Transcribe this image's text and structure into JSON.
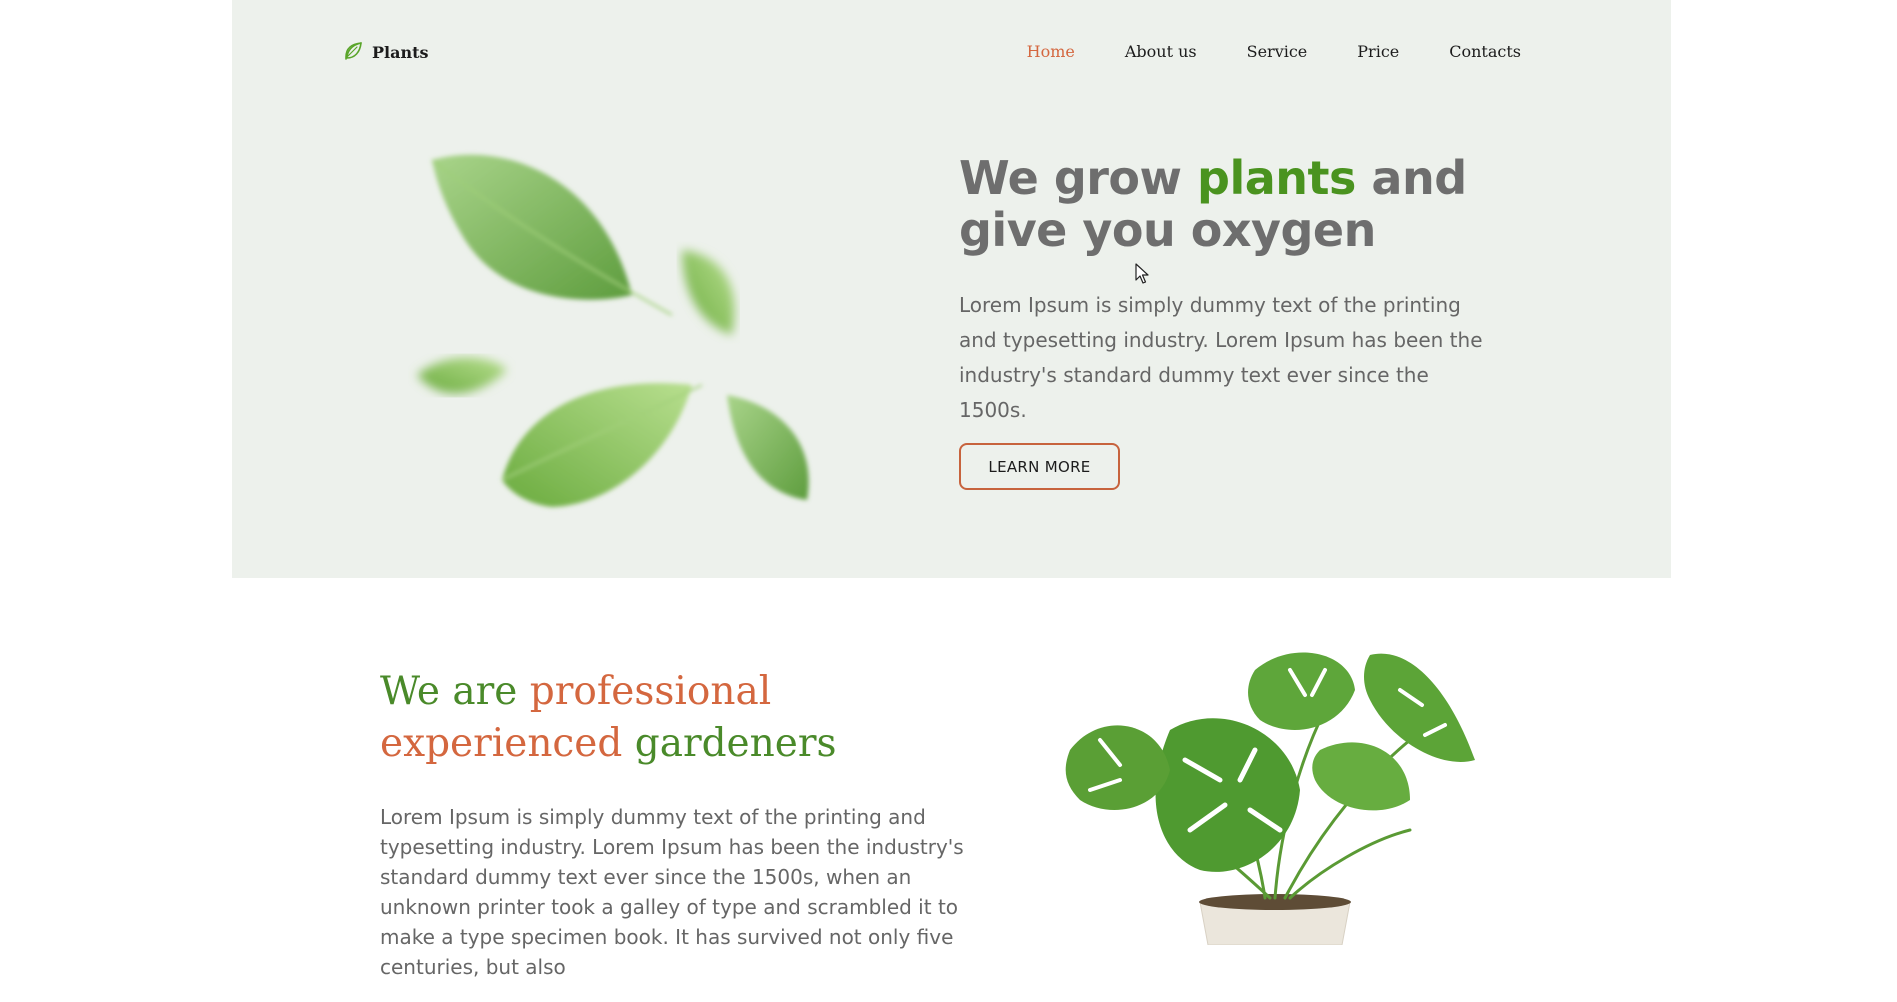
{
  "brand": {
    "name": "Plants",
    "icon": "leaf-icon"
  },
  "nav": {
    "items": [
      {
        "label": "Home",
        "active": true
      },
      {
        "label": "About us",
        "active": false
      },
      {
        "label": "Service",
        "active": false
      },
      {
        "label": "Price",
        "active": false
      },
      {
        "label": "Contacts",
        "active": false
      }
    ]
  },
  "hero": {
    "title_part1": "We grow ",
    "title_accent": "plants",
    "title_part2": " and give you oxygen",
    "text": "Lorem Ipsum is simply dummy text of the printing and typesetting industry. Lorem Ipsum has been the industry's standard dummy text ever since the 1500s.",
    "button_label": "LEARN MORE"
  },
  "about": {
    "title_part1": "We are ",
    "title_part2": "professional experienced",
    "title_part3": " gardeners",
    "text": "Lorem Ipsum is simply dummy text of the printing and typesetting industry. Lorem Ipsum has been the industry's standard dummy text ever since the 1500s, when an unknown printer took a galley of type and scrambled it to make a type specimen book. It has survived not only five centuries, but also"
  },
  "colors": {
    "accent_orange": "#d4673f",
    "accent_green": "#4a931f",
    "hero_bg": "#edf1ec"
  }
}
